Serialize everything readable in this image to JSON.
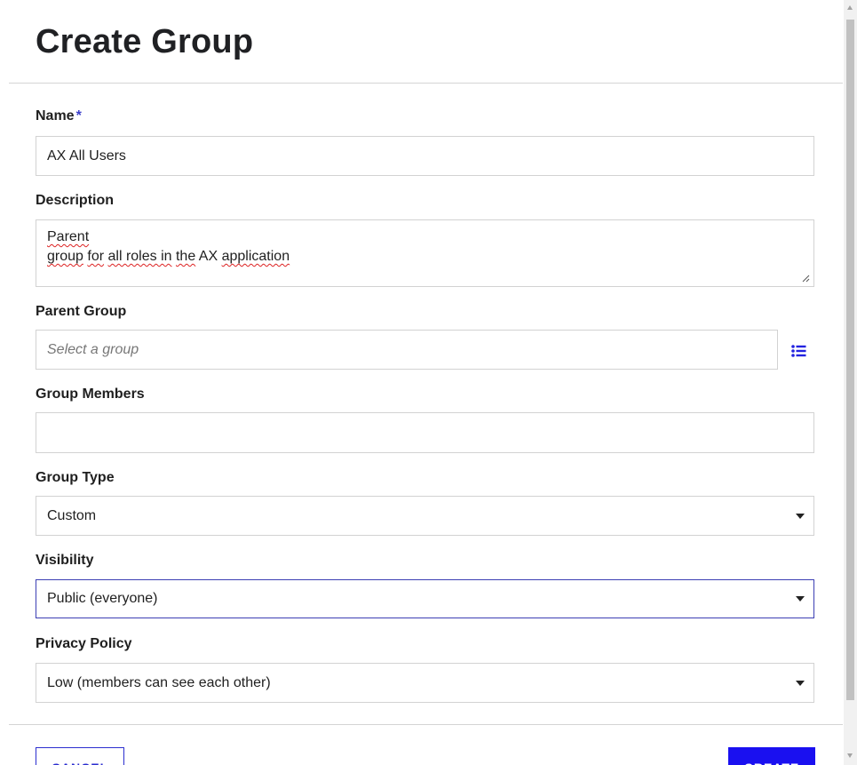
{
  "dialog": {
    "title": "Create Group",
    "name": {
      "label": "Name",
      "required_mark": "*",
      "value": "AX All Users"
    },
    "description": {
      "label": "Description",
      "line1": "Parent",
      "line2_words": [
        "group",
        "for",
        "all roles in",
        "the",
        "AX",
        "application"
      ],
      "value": "Parent\ngroup for all roles in the AX application"
    },
    "parent_group": {
      "label": "Parent Group",
      "placeholder": "Select a group",
      "browse_icon": "list-icon"
    },
    "group_members": {
      "label": "Group Members",
      "value": ""
    },
    "group_type": {
      "label": "Group Type",
      "selected": "Custom"
    },
    "visibility": {
      "label": "Visibility",
      "selected": "Public (everyone)"
    },
    "privacy_policy": {
      "label": "Privacy Policy",
      "selected": "Low (members can see each other)"
    },
    "buttons": {
      "cancel": "CANCEL",
      "create": "CREATE"
    }
  },
  "colors": {
    "accent": "#1a10f0",
    "required": "#3b3ec9",
    "focus_border": "#3c3fb4",
    "spellcheck": "#dd2222"
  }
}
